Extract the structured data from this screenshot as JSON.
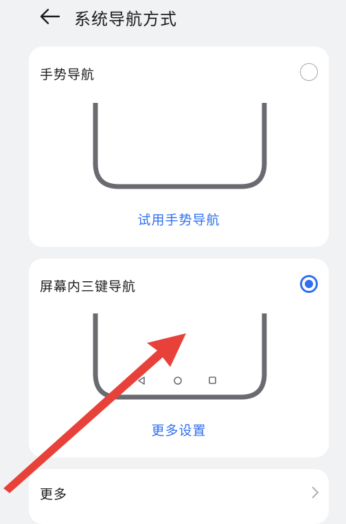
{
  "header": {
    "title": "系统导航方式"
  },
  "options": [
    {
      "title": "手势导航",
      "selected": false,
      "link": "试用手势导航"
    },
    {
      "title": "屏幕内三键导航",
      "selected": true,
      "link": "更多设置"
    }
  ],
  "more": {
    "label": "更多"
  },
  "colors": {
    "accent": "#2f6ff0",
    "background": "#f1f2f4",
    "phone_frame": "#6a6b70",
    "annotation_arrow": "#e8413a"
  }
}
